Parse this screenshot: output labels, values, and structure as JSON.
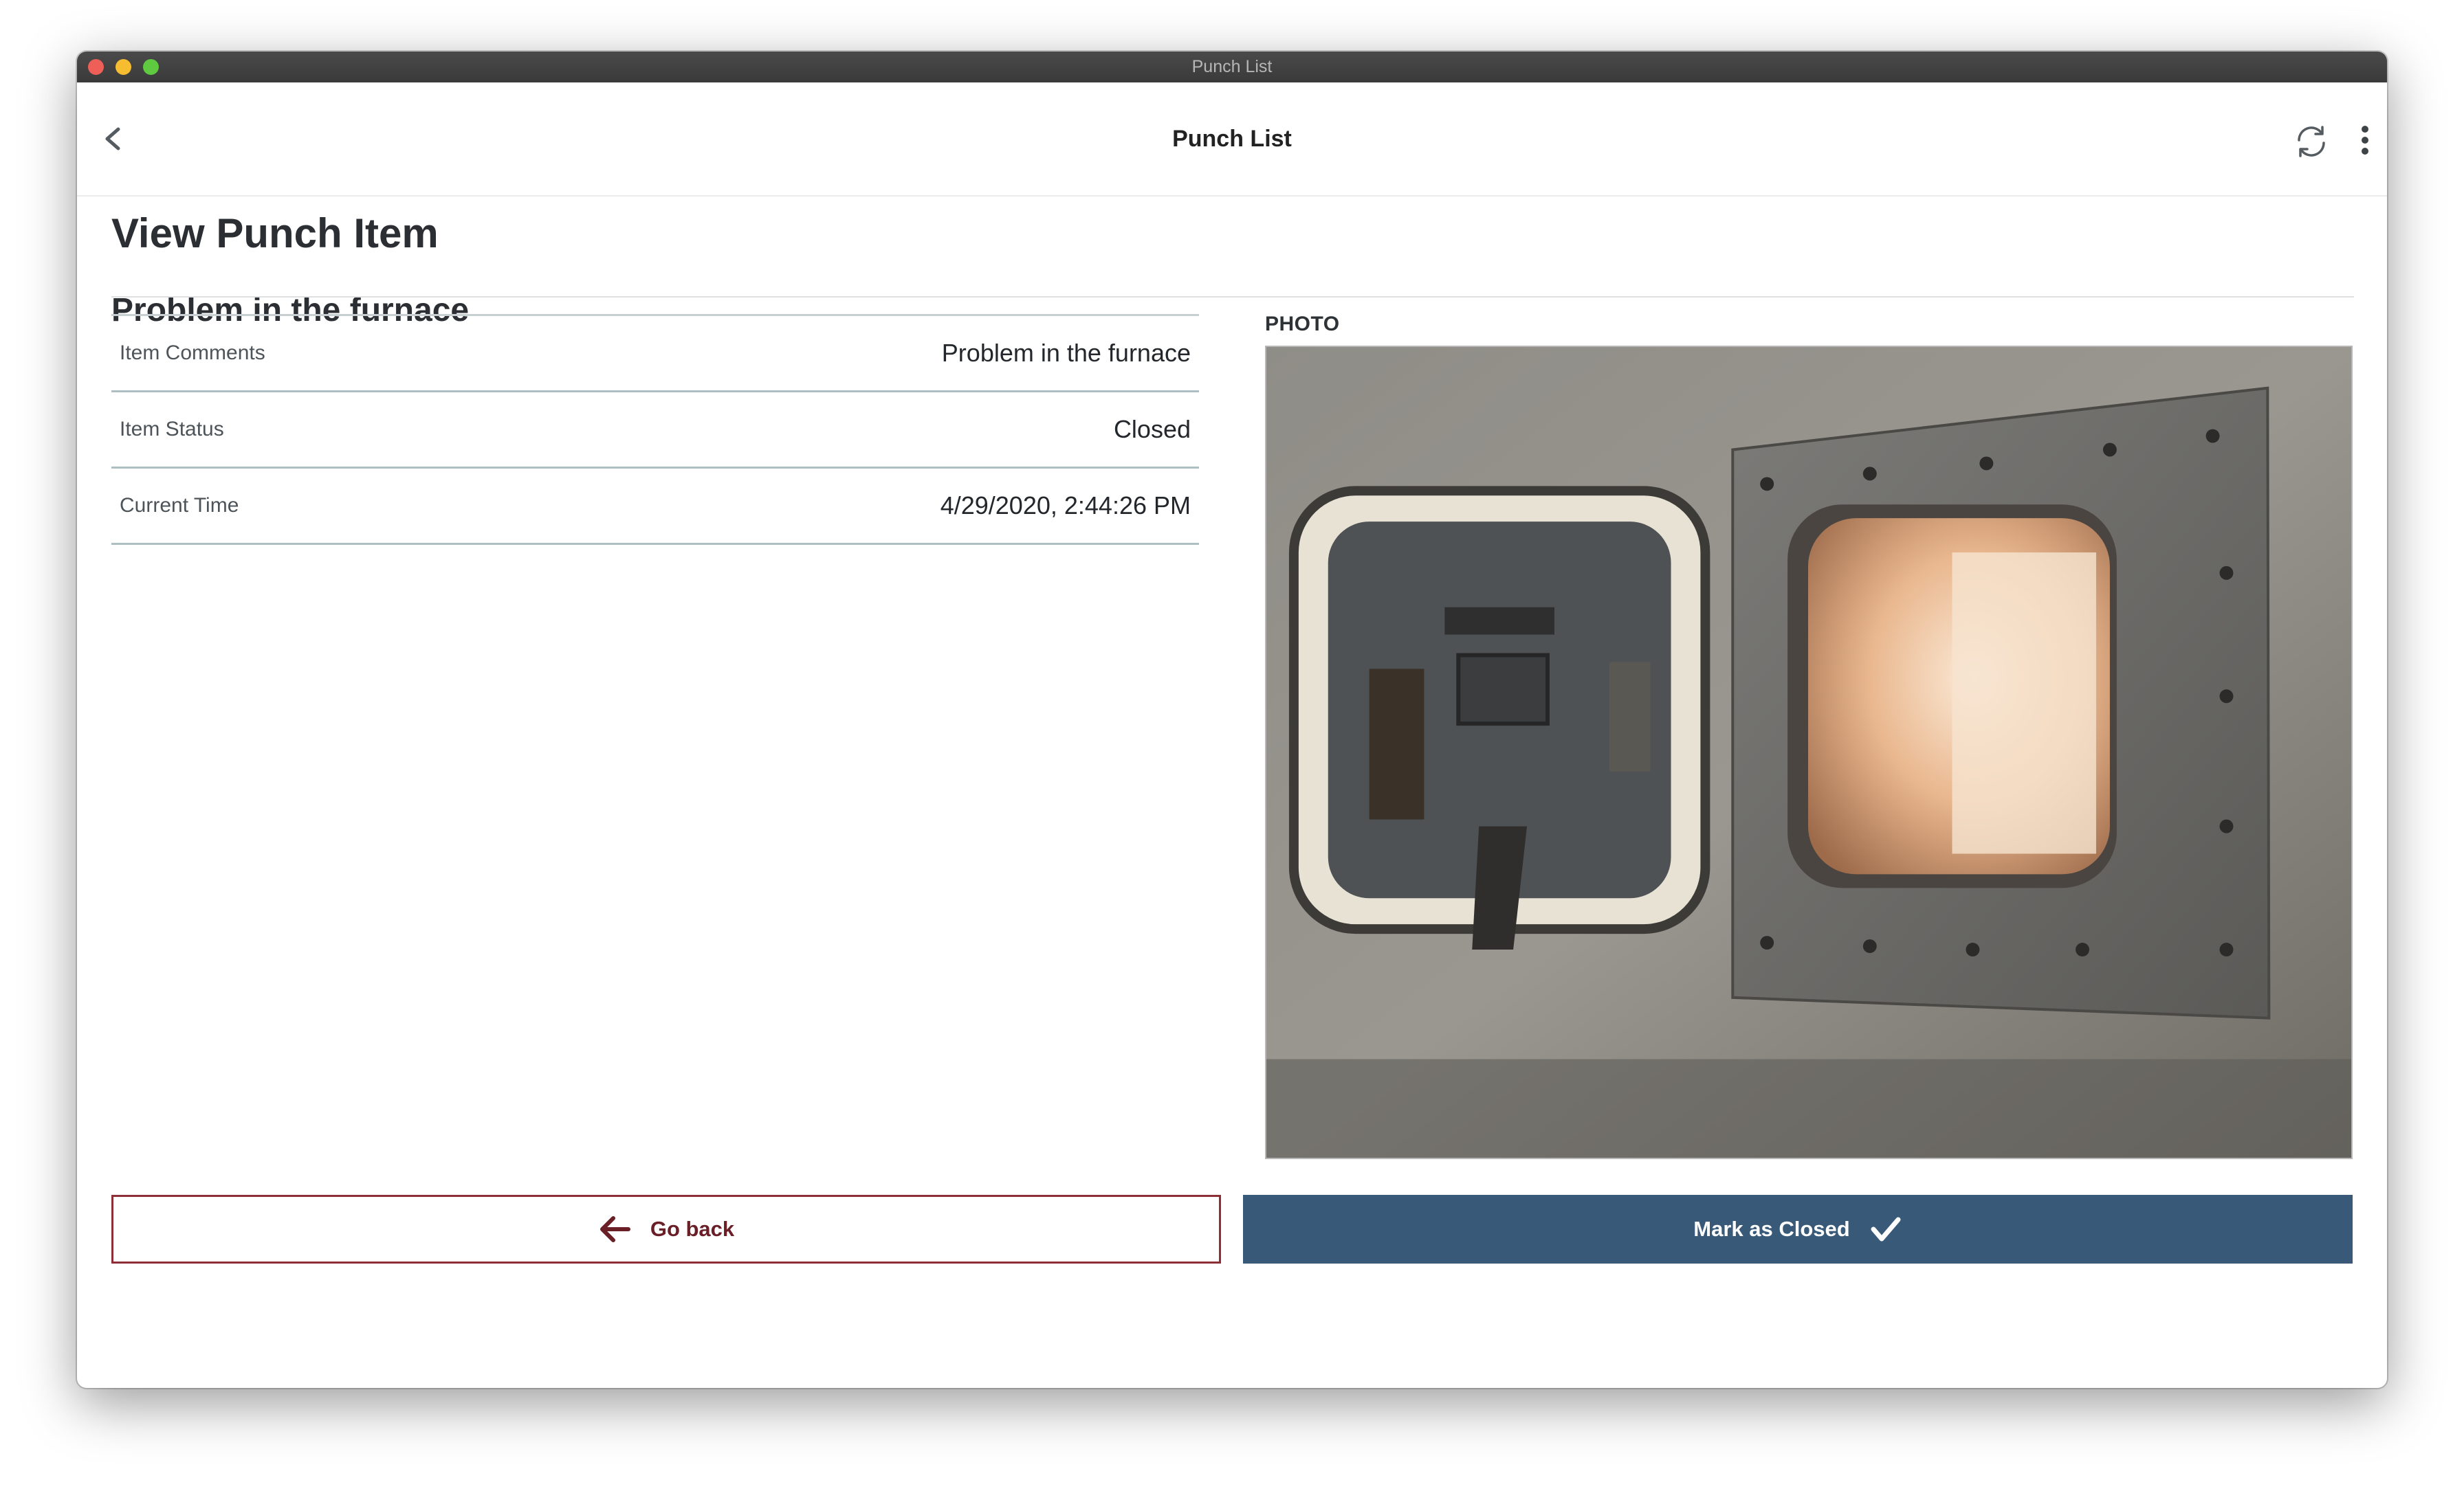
{
  "window": {
    "title": "Punch List"
  },
  "appbar": {
    "title": "Punch List",
    "icons": {
      "back": "chevron-left-icon",
      "sync": "sync-icon",
      "more": "more-vertical-icon"
    }
  },
  "page": {
    "heading": "View Punch Item",
    "item_title": "Problem in the furnace"
  },
  "details": {
    "rows": [
      {
        "label": "Item Comments",
        "value": "Problem in the furnace"
      },
      {
        "label": "Item Status",
        "value": "Closed"
      },
      {
        "label": "Current Time",
        "value": "4/29/2020, 2:44:26 PM"
      }
    ]
  },
  "photo": {
    "label": "PHOTO"
  },
  "actions": {
    "back_label": "Go back",
    "close_label": "Mark as Closed",
    "back_icon": "arrow-left-icon",
    "close_icon": "checkmark-icon"
  },
  "colors": {
    "primary": "#385a78",
    "back_accent": "#8e2f38",
    "divider": "#aebfc3"
  }
}
